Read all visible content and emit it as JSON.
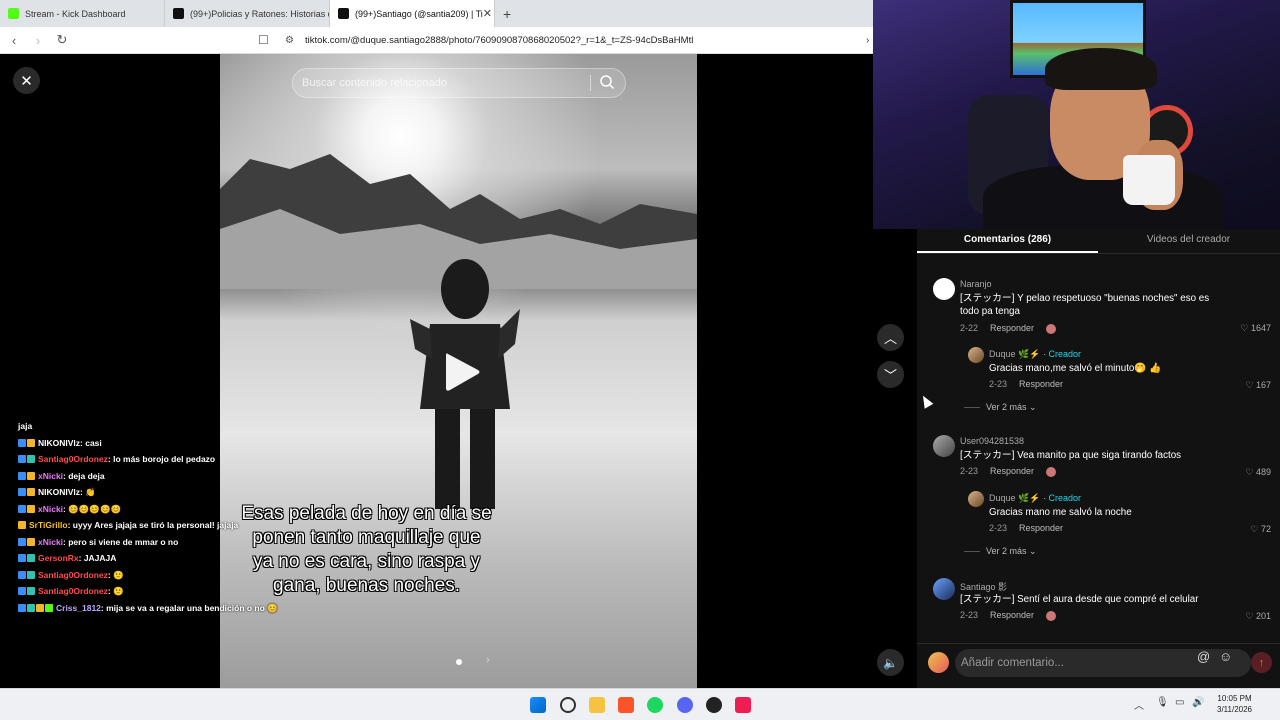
{
  "browser": {
    "tabs": [
      {
        "label": "Stream - Kick Dashboard"
      },
      {
        "label": "(99+)Policias y Ratones: Historias de"
      },
      {
        "label": "(99+)Santiago (@santia209) | Ti"
      }
    ],
    "new_tab": "+",
    "url": "tiktok.com/@duque.santiago2888/photo/7609090870868020502?_r=1&_t=ZS-94cDsBaHMtl"
  },
  "post": {
    "search_placeholder": "Buscar contenido relacionado",
    "caption_lines": [
      "Esas pelada de hoy en día se",
      "ponen tanto maquillaje que",
      "ya no es cara, sino raspa y",
      "gana, buenas noches."
    ]
  },
  "chat": [
    {
      "badges": [],
      "user": "",
      "user_color": "u-white",
      "text": "jaja"
    },
    {
      "badges": [
        "b-blue",
        "b-yellow"
      ],
      "user": "NIKONIVlz",
      "user_color": "u-white",
      "text": " : casi"
    },
    {
      "badges": [
        "b-blue",
        "b-teal"
      ],
      "user": "Santiag0Ordonez",
      "user_color": "u-red",
      "text": " : lo más borojo del pedazo"
    },
    {
      "badges": [
        "b-blue",
        "b-yellow"
      ],
      "user": "xNicki",
      "user_color": "u-pink",
      "text": " : deja deja"
    },
    {
      "badges": [
        "b-blue",
        "b-yellow"
      ],
      "user": "NIKONIVlz",
      "user_color": "u-white",
      "text": " : 👏"
    },
    {
      "badges": [
        "b-blue",
        "b-yellow"
      ],
      "user": "xNicki",
      "user_color": "u-pink",
      "text": " : 😊😊😊😊😊"
    },
    {
      "badges": [
        "b-yellow"
      ],
      "user": "SrTiGrillo",
      "user_color": "u-yellow",
      "text": " : uyyy Ares jajaja se tiró la personal! jajaja"
    },
    {
      "badges": [
        "b-blue",
        "b-yellow"
      ],
      "user": "xNicki",
      "user_color": "u-pink",
      "text": " : pero si viene de mmar o no"
    },
    {
      "badges": [
        "b-blue",
        "b-teal"
      ],
      "user": "GersonRx",
      "user_color": "u-red",
      "text": " : JAJAJA"
    },
    {
      "badges": [
        "b-blue",
        "b-teal"
      ],
      "user": "Santiag0Ordonez",
      "user_color": "u-red",
      "text": " : 🙂"
    },
    {
      "badges": [
        "b-blue",
        "b-teal"
      ],
      "user": "Santiag0Ordonez",
      "user_color": "u-red",
      "text": " : 🙂"
    },
    {
      "badges": [
        "b-blue",
        "b-teal",
        "b-yellow",
        "b-green"
      ],
      "user": "Criss_1812",
      "user_color": "u-lilac",
      "text": " : mija se va a regalar una bendición o no 😊"
    }
  ],
  "panel": {
    "tabs": [
      "Comentarios (286)",
      "Videos del creador"
    ],
    "comments": [
      {
        "user": "Naranjo",
        "text": "[ステッカー] Y pelao respetuoso \"buenas noches\" eso es todo pa tenga",
        "date": "2-22",
        "reply": "Responder",
        "likes": "1647",
        "creator_reply": {
          "user": "Duque",
          "tag": "· Creador",
          "text": "Gracias mano,me salvó el minuto🤭 👍",
          "date": "2-23",
          "reply": "Responder",
          "likes": "167"
        },
        "more": "Ver 2 más"
      },
      {
        "user": "User094281538",
        "text": "[ステッカー] Vea manito pa que siga tirando factos",
        "date": "2-23",
        "reply": "Responder",
        "likes": "489",
        "creator_reply": {
          "user": "Duque",
          "tag": "· Creador",
          "text": "Gracias mano me salvó la noche",
          "date": "2-23",
          "reply": "Responder",
          "likes": "72"
        },
        "more": "Ver 2 más"
      },
      {
        "user": "Santiago 影",
        "text": "[ステッカー] Sentí el aura desde que compré el celular",
        "date": "2-23",
        "reply": "Responder",
        "likes": "201"
      }
    ],
    "input_placeholder": "Añadir comentario..."
  },
  "taskbar": {
    "time": "10:05 PM",
    "date": "3/11/2026"
  }
}
